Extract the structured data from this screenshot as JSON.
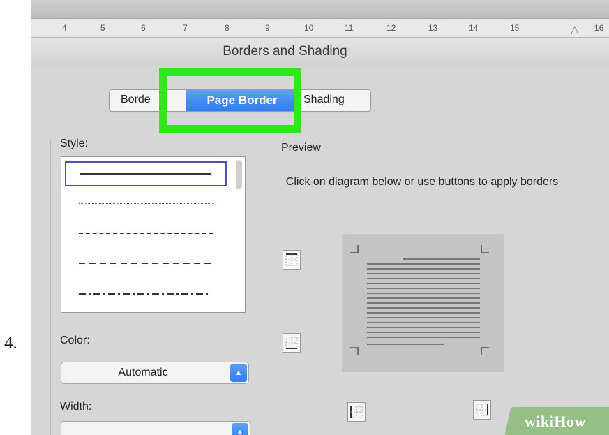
{
  "step": {
    "number": "4."
  },
  "ruler": {
    "numbers": [
      "4",
      "5",
      "6",
      "7",
      "8",
      "9",
      "10",
      "11",
      "12",
      "13",
      "14",
      "15",
      "16"
    ]
  },
  "dialog": {
    "title": "Borders and Shading",
    "tabs": [
      {
        "label": "Borde",
        "active": false
      },
      {
        "label": "Page Border",
        "active": true
      },
      {
        "label": "Shading",
        "active": false
      }
    ],
    "highlight_color": "#33e51d",
    "left": {
      "style_label": "Style:",
      "style_options": [
        "solid",
        "dotted",
        "dashed-small",
        "dashed-medium",
        "dash-dot"
      ],
      "selected_style": "solid",
      "color_label": "Color:",
      "color_value": "Automatic",
      "width_label": "Width:"
    },
    "right": {
      "preview_label": "Preview",
      "instructions": "Click on diagram below or use buttons to apply borders"
    }
  },
  "watermark": {
    "text": "wikiHow"
  },
  "colors": {
    "accent": "#2e7ef0",
    "highlight": "#33e51d",
    "watermark_bg": "#95bf87"
  }
}
